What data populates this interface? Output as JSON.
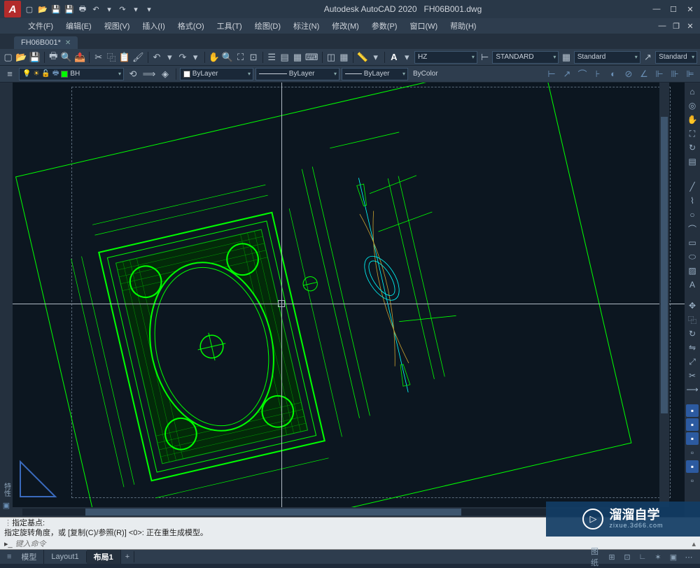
{
  "app": {
    "title": "Autodesk AutoCAD 2020",
    "filename": "FH06B001.dwg"
  },
  "menus": [
    {
      "label": "文件(F)"
    },
    {
      "label": "编辑(E)"
    },
    {
      "label": "视图(V)"
    },
    {
      "label": "插入(I)"
    },
    {
      "label": "格式(O)"
    },
    {
      "label": "工具(T)"
    },
    {
      "label": "绘图(D)"
    },
    {
      "label": "标注(N)"
    },
    {
      "label": "修改(M)"
    },
    {
      "label": "参数(P)"
    },
    {
      "label": "窗口(W)"
    },
    {
      "label": "帮助(H)"
    }
  ],
  "doc_tab": {
    "label": "FH06B001*"
  },
  "toolbar1": {
    "text_style": "HZ",
    "dim_style": "STANDARD",
    "table_style": "Standard",
    "mleader_style": "Standard"
  },
  "toolbar2": {
    "layer": "BH",
    "layer_color": "#00ff00",
    "color": "ByLayer",
    "linetype": "ByLayer",
    "lineweight": "ByLayer",
    "plotstyle": "ByColor"
  },
  "sidebar": {
    "label": "特性"
  },
  "command": {
    "line1": "指定基点:",
    "line2": "指定旋转角度，或 [复制(C)/参照(R)] <0>:  正在重生成模型。",
    "placeholder": "键入命令"
  },
  "layout_tabs": [
    {
      "label": "模型",
      "active": false
    },
    {
      "label": "Layout1",
      "active": false
    },
    {
      "label": "布局1",
      "active": true
    }
  ],
  "status": {
    "label": "图纸"
  },
  "watermark": {
    "main": "溜溜自学",
    "sub": "zixue.3d66.com"
  }
}
